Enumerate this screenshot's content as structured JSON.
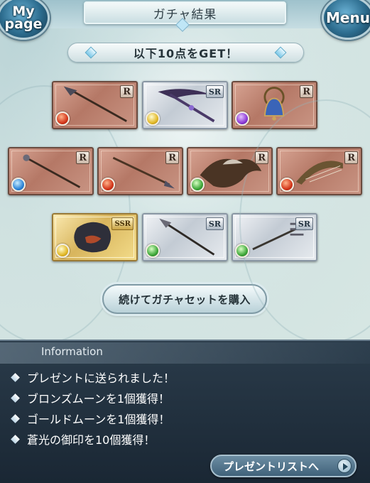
{
  "header": {
    "title": "ガチャ結果",
    "mypage_label_line1": "My",
    "mypage_label_line2": "page",
    "menu_label": "Menu"
  },
  "result_banner": "以下10点をGET！",
  "cards": [
    {
      "rarity": "R",
      "element": "fire",
      "item": "spear"
    },
    {
      "rarity": "SR",
      "element": "light",
      "item": "scythe"
    },
    {
      "rarity": "R",
      "element": "dark",
      "item": "bell"
    },
    {
      "rarity": "R",
      "element": "water",
      "item": "staff"
    },
    {
      "rarity": "R",
      "element": "fire",
      "item": "lance"
    },
    {
      "rarity": "R",
      "element": "wind",
      "item": "summon-beast"
    },
    {
      "rarity": "R",
      "element": "fire",
      "item": "harp"
    },
    {
      "rarity": "SSR",
      "element": "light",
      "item": "summon-armored"
    },
    {
      "rarity": "SR",
      "element": "wind",
      "item": "spear"
    },
    {
      "rarity": "SR",
      "element": "wind",
      "item": "trident"
    }
  ],
  "buy_button": "続けてガチャセットを購入",
  "info": {
    "title": "Information",
    "items": [
      "プレゼントに送られました！",
      "ブロンズムーンを1個獲得！",
      "ゴールドムーンを1個獲得！",
      "蒼光の御印を10個獲得！"
    ],
    "present_button": "プレゼントリストへ"
  },
  "colors": {
    "rarity_r": "#b57866",
    "rarity_sr": "#c3cbd4",
    "rarity_ssr": "#d8b55d",
    "info_bg": "#1a2734"
  }
}
